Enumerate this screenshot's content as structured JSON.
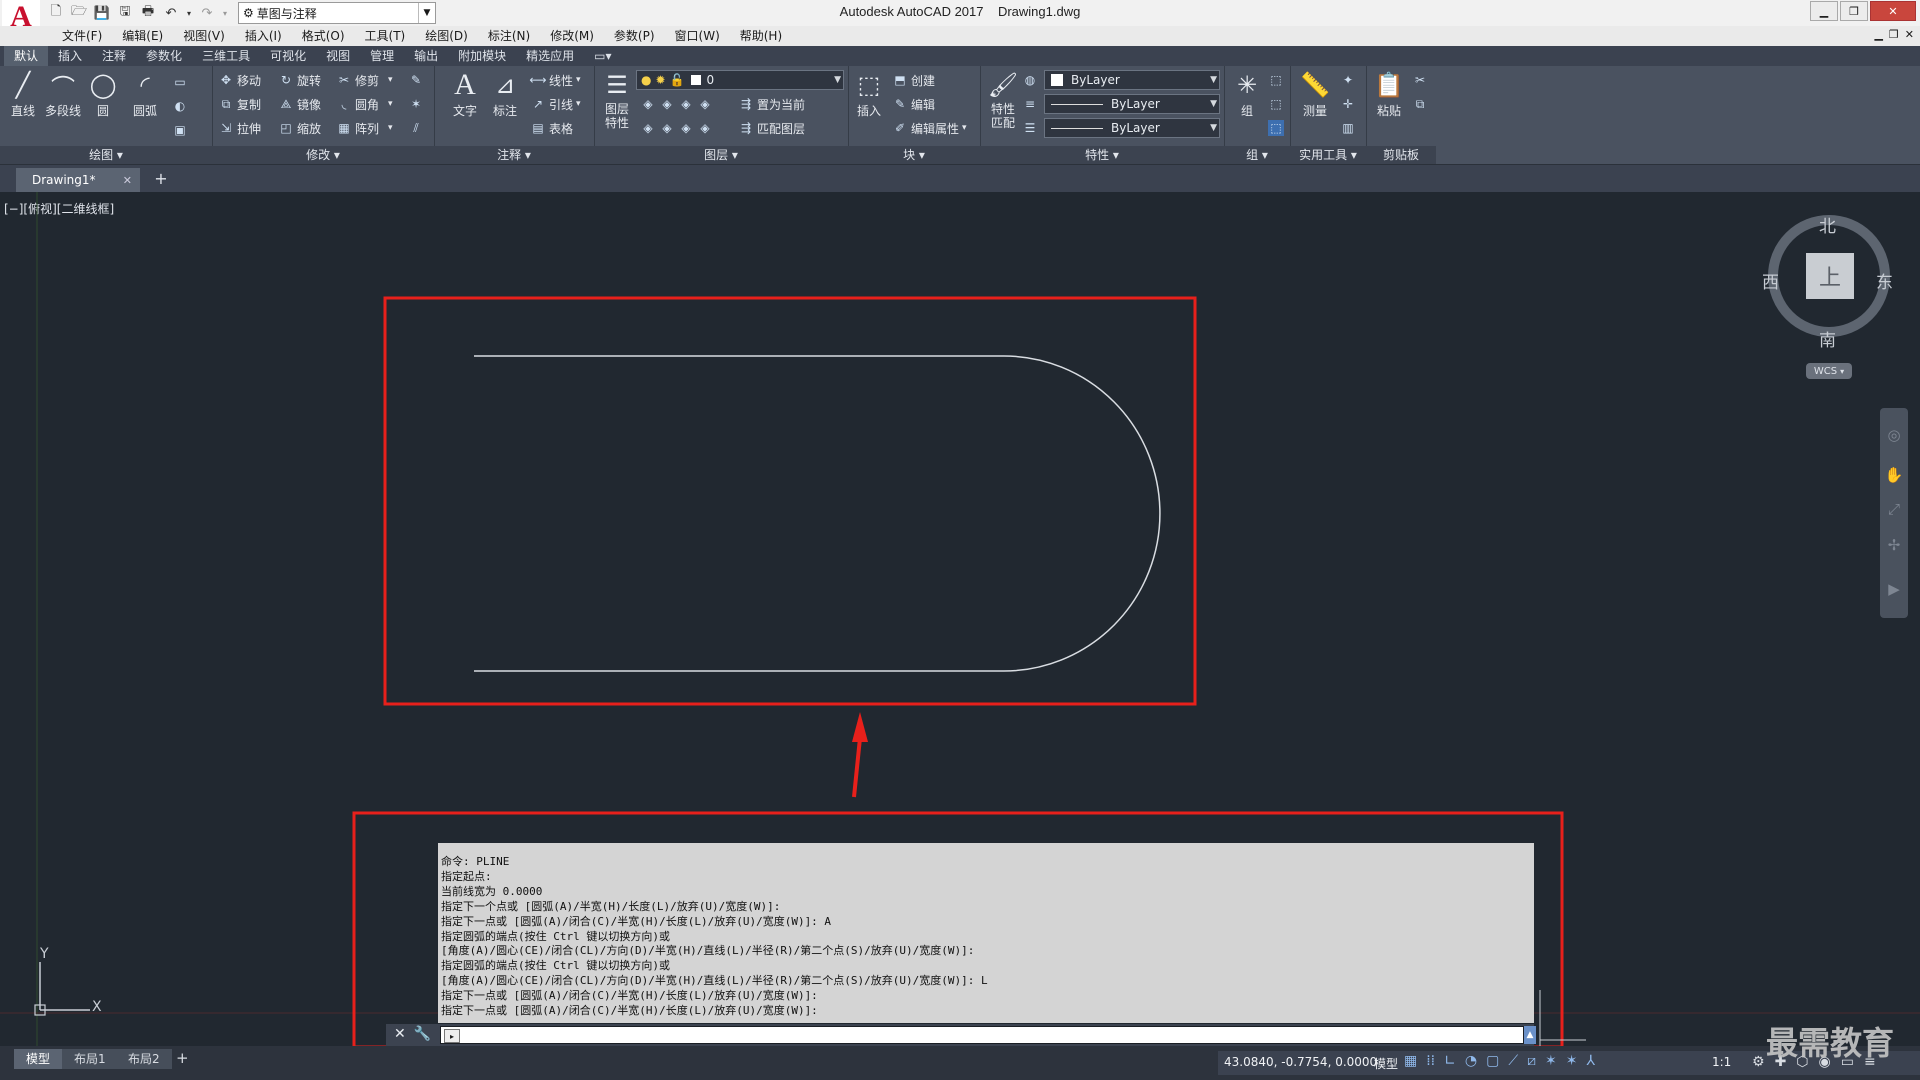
{
  "app": {
    "title": "Autodesk AutoCAD 2017    Drawing1.dwg",
    "logo_letter": "A",
    "workspace": "草图与注释",
    "watermark": "最需教育"
  },
  "menubar": [
    "文件(F)",
    "编辑(E)",
    "视图(V)",
    "插入(I)",
    "格式(O)",
    "工具(T)",
    "绘图(D)",
    "标注(N)",
    "修改(M)",
    "参数(P)",
    "窗口(W)",
    "帮助(H)"
  ],
  "ribbon_tabs": [
    "默认",
    "插入",
    "注释",
    "参数化",
    "三维工具",
    "可视化",
    "视图",
    "管理",
    "输出",
    "附加模块",
    "精选应用"
  ],
  "ribbon": {
    "draw": {
      "title": "绘图",
      "line": "直线",
      "polyline": "多段线",
      "circle": "圆",
      "arc": "圆弧"
    },
    "modify": {
      "title": "修改",
      "move": "移动",
      "rotate": "旋转",
      "trim": "修剪",
      "copy": "复制",
      "mirror": "镜像",
      "fillet": "圆角",
      "stretch": "拉伸",
      "scale": "缩放",
      "array": "阵列"
    },
    "annotation": {
      "title": "注释",
      "text": "文字",
      "dimension": "标注",
      "linear": "线性",
      "leader": "引线",
      "table": "表格"
    },
    "layers": {
      "title": "图层",
      "layer_props": "图层特性",
      "layer_value": "0",
      "set_current": "置为当前",
      "match_layer": "匹配图层"
    },
    "block": {
      "title": "块",
      "insert": "插入",
      "create": "创建",
      "edit": "编辑",
      "edit_attr": "编辑属性"
    },
    "properties": {
      "title": "特性",
      "match_props": "特性匹配",
      "color": "ByLayer",
      "linetype": "ByLayer",
      "lineweight": "ByLayer"
    },
    "groups": {
      "title": "组",
      "group": "组"
    },
    "utilities": {
      "title": "实用工具",
      "measure": "测量"
    },
    "clipboard": {
      "title": "剪贴板",
      "paste": "粘贴"
    }
  },
  "document_tab": {
    "name": "Drawing1*"
  },
  "viewport": {
    "label": "[−][俯视][二维线框]"
  },
  "viewcube": {
    "north": "北",
    "south": "南",
    "east": "东",
    "west": "西",
    "top": "上",
    "wcs": "WCS"
  },
  "ucs": {
    "x": "X",
    "y": "Y"
  },
  "command_history": [
    "命令: PLINE",
    "指定起点:",
    "当前线宽为 0.0000",
    "指定下一个点或 [圆弧(A)/半宽(H)/长度(L)/放弃(U)/宽度(W)]:",
    "指定下一点或 [圆弧(A)/闭合(C)/半宽(H)/长度(L)/放弃(U)/宽度(W)]: A",
    "指定圆弧的端点(按住 Ctrl 键以切换方向)或",
    "[角度(A)/圆心(CE)/闭合(CL)/方向(D)/半宽(H)/直线(L)/半径(R)/第二个点(S)/放弃(U)/宽度(W)]:",
    "指定圆弧的端点(按住 Ctrl 键以切换方向)或",
    "[角度(A)/圆心(CE)/闭合(CL)/方向(D)/半宽(H)/直线(L)/半径(R)/第二个点(S)/放弃(U)/宽度(W)]: L",
    "指定下一点或 [圆弧(A)/闭合(C)/半宽(H)/长度(L)/放弃(U)/宽度(W)]:",
    "指定下一点或 [圆弧(A)/闭合(C)/半宽(H)/长度(L)/放弃(U)/宽度(W)]:"
  ],
  "command_input": {
    "value": ""
  },
  "layout_tabs": [
    "模型",
    "布局1",
    "布局2"
  ],
  "status": {
    "coords": "43.0840, -0.7754, 0.0000",
    "model": "模型",
    "scale": "1:1"
  },
  "colors": {
    "annotation_red": "#e8201b",
    "canvas_bg": "#212830",
    "ribbon_bg": "#4a5260"
  }
}
